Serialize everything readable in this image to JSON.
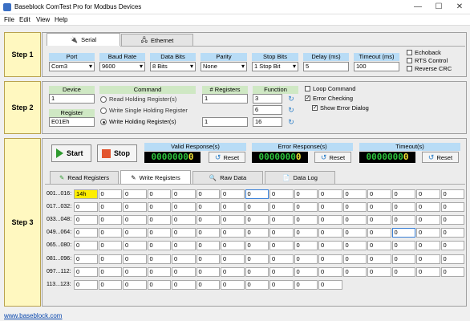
{
  "window": {
    "title": "Baseblock ComTest Pro for Modbus Devices",
    "minimize": "—",
    "maximize": "☐",
    "close": "✕"
  },
  "menu": [
    "File",
    "Edit",
    "View",
    "Help"
  ],
  "steps": {
    "step1": "Step 1",
    "step2": "Step 2",
    "step3": "Step 3"
  },
  "connection": {
    "tabs": [
      "Serial",
      "Ethernet"
    ],
    "port": {
      "label": "Port",
      "value": "Com3"
    },
    "baud": {
      "label": "Baud Rate",
      "value": "9600"
    },
    "databits": {
      "label": "Data Bits",
      "value": "8 Bits"
    },
    "parity": {
      "label": "Parity",
      "value": "None"
    },
    "stopbits": {
      "label": "Stop Bits",
      "value": "1 Stop Bit"
    },
    "delay": {
      "label": "Delay (ms)",
      "value": "5"
    },
    "timeout": {
      "label": "Timeout (ms)",
      "value": "100"
    },
    "options": [
      {
        "label": "Echoback",
        "checked": false
      },
      {
        "label": "RTS Control",
        "checked": false
      },
      {
        "label": "Reverse CRC",
        "checked": false
      }
    ]
  },
  "command": {
    "device_label": "Device",
    "device_value": "1",
    "register_label": "Register",
    "register_value": "E01Eh",
    "command_label": "Command",
    "options": [
      {
        "label": "Read Holding Register(s)",
        "selected": false
      },
      {
        "label": "Write Single Holding Register",
        "selected": false
      },
      {
        "label": "Write Holding Register(s)",
        "selected": true
      }
    ],
    "nregs_label": "# Registers",
    "nregs": [
      "1",
      "",
      "1"
    ],
    "function_label": "Function",
    "functions": [
      "3",
      "6",
      "16"
    ],
    "loop_label": "Loop Command",
    "loop_checked": false,
    "errcheck_label": "Error Checking",
    "errcheck_checked": true,
    "showerr_label": "Show Error Dialog",
    "showerr_checked": true
  },
  "run": {
    "start": "Start",
    "stop": "Stop",
    "counters": [
      {
        "label": "Valid Response(s)",
        "digits": "00000000",
        "reset": "Reset"
      },
      {
        "label": "Error Response(s)",
        "digits": "00000000",
        "reset": "Reset"
      },
      {
        "label": "Timeout(s)",
        "digits": "00000000",
        "reset": "Reset"
      }
    ]
  },
  "datatabs": [
    "Read Registers",
    "Write Registers",
    "Raw Data",
    "Data Log"
  ],
  "grid": {
    "rows": [
      {
        "label": "001...016:",
        "cells": [
          "14h",
          "0",
          "0",
          "0",
          "0",
          "0",
          "0",
          "0",
          "0",
          "0",
          "0",
          "0",
          "0",
          "0",
          "0",
          "0"
        ]
      },
      {
        "label": "017...032:",
        "cells": [
          "0",
          "0",
          "0",
          "0",
          "0",
          "0",
          "0",
          "0",
          "0",
          "0",
          "0",
          "0",
          "0",
          "0",
          "0",
          "0"
        ]
      },
      {
        "label": "033...048:",
        "cells": [
          "0",
          "0",
          "0",
          "0",
          "0",
          "0",
          "0",
          "0",
          "0",
          "0",
          "0",
          "0",
          "0",
          "0",
          "0",
          "0"
        ]
      },
      {
        "label": "049...064:",
        "cells": [
          "0",
          "0",
          "0",
          "0",
          "0",
          "0",
          "0",
          "0",
          "0",
          "0",
          "0",
          "0",
          "0",
          "0",
          "0",
          "0"
        ]
      },
      {
        "label": "065...080:",
        "cells": [
          "0",
          "0",
          "0",
          "0",
          "0",
          "0",
          "0",
          "0",
          "0",
          "0",
          "0",
          "0",
          "0",
          "0",
          "0",
          "0"
        ]
      },
      {
        "label": "081...096:",
        "cells": [
          "0",
          "0",
          "0",
          "0",
          "0",
          "0",
          "0",
          "0",
          "0",
          "0",
          "0",
          "0",
          "0",
          "0",
          "0",
          "0"
        ]
      },
      {
        "label": "097...112:",
        "cells": [
          "0",
          "0",
          "0",
          "0",
          "0",
          "0",
          "0",
          "0",
          "0",
          "0",
          "0",
          "0",
          "0",
          "0",
          "0",
          "0"
        ]
      },
      {
        "label": "113...123:",
        "cells": [
          "0",
          "0",
          "0",
          "0",
          "0",
          "0",
          "0",
          "0",
          "0",
          "0",
          "0"
        ]
      }
    ]
  },
  "footer_link": "www.baseblock.com",
  "colors": {
    "highlight": "#ffee00",
    "header_blue": "#b8dcf6",
    "header_green": "#cfe8c4",
    "step_yellow": "#fff8c0",
    "led_green": "#2ec43c",
    "led_yellow": "#f2e437"
  }
}
